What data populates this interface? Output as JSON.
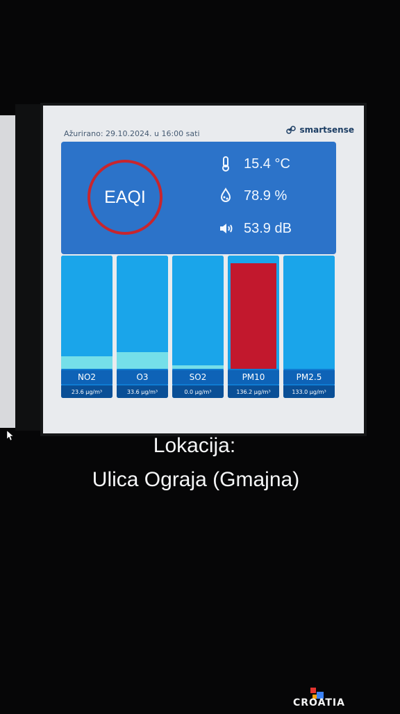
{
  "updated_text": "Ažurirano: 29.10.2024. u 16:00 sati",
  "brand": "smartsense",
  "aqi_label": "EAQI",
  "metrics": [
    {
      "icon": "thermometer-icon",
      "value": "15.4 °C"
    },
    {
      "icon": "humidity-icon",
      "value": "78.9 %"
    },
    {
      "icon": "speaker-icon",
      "value": "53.9 dB"
    }
  ],
  "pollutants": [
    {
      "name": "NO2",
      "value": "23.6 µg/m³",
      "level": 0.11
    },
    {
      "name": "O3",
      "value": "33.6 µg/m³",
      "level": 0.15
    },
    {
      "name": "SO2",
      "value": "0.0 µg/m³",
      "level": 0.03
    },
    {
      "name": "PM10",
      "value": "136.2 µg/m³",
      "level": 0.93
    },
    {
      "name": "PM2.5",
      "value": "133.0 µg/m³",
      "level": 0.0
    }
  ],
  "location_label": "Lokacija:",
  "location_value": "Ulica Ograja (Gmajna)",
  "colors": {
    "screen_bg": "#e9ebee",
    "top_card": "#2c73c9",
    "bar_bg": "#1aa5ea",
    "level_cyan": "#7fe6e9",
    "pm10_red": "#c2182d",
    "ring_red": "#c8252d"
  },
  "logo_text": "CROATIA"
}
